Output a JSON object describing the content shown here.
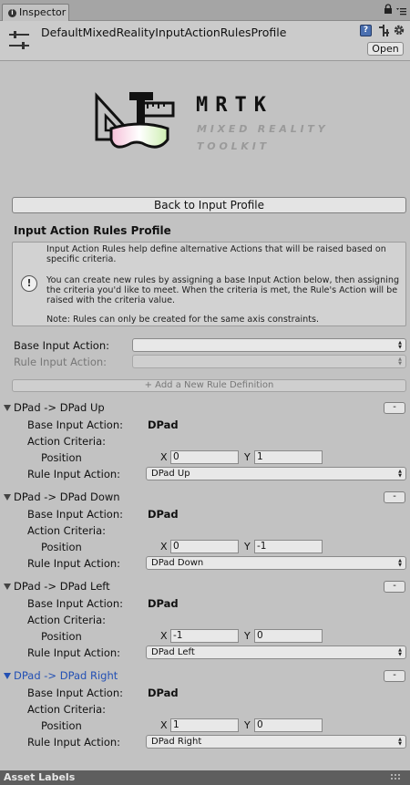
{
  "tab": {
    "title": "Inspector"
  },
  "header": {
    "title": "DefaultMixedRealityInputActionRulesProfile",
    "open_label": "Open",
    "help_glyph": "?"
  },
  "logo": {
    "name": "MRTK",
    "sub1": "MIXED REALITY",
    "sub2": "TOOLKIT"
  },
  "back_button": "Back to Input Profile",
  "section_title": "Input Action Rules Profile",
  "help": {
    "warn_glyph": "!",
    "p1": "Input Action Rules help define alternative Actions that will be raised based on specific criteria.",
    "p2": "You can create new rules by assigning a base Input Action below, then assigning the criteria you'd like to meet. When the criteria is met, the Rule's Action will be raised with the criteria value.",
    "p3": "Note: Rules can only be created for the same axis constraints."
  },
  "base_input_label": "Base Input Action:",
  "base_input_value": "",
  "rule_input_label": "Rule Input Action:",
  "rule_input_value": "",
  "add_rule_button": "+ Add a New Rule Definition",
  "labels": {
    "base": "Base Input Action:",
    "criteria": "Action Criteria:",
    "position": "Position",
    "rule": "Rule Input Action:",
    "x": "X",
    "y": "Y",
    "remove": "-"
  },
  "rules": [
    {
      "title": "DPad -> DPad Up",
      "base": "DPad",
      "x": "0",
      "y": "1",
      "rule": "DPad Up"
    },
    {
      "title": "DPad -> DPad Down",
      "base": "DPad",
      "x": "0",
      "y": "-1",
      "rule": "DPad Down"
    },
    {
      "title": "DPad -> DPad Left",
      "base": "DPad",
      "x": "-1",
      "y": "0",
      "rule": "DPad Left"
    },
    {
      "title": "DPad -> DPad Right",
      "base": "DPad",
      "x": "1",
      "y": "0",
      "rule": "DPad Right",
      "selected": true
    }
  ],
  "footer": {
    "asset_labels": "Asset Labels"
  },
  "colors": {
    "selected_text": "#2350b4",
    "panel_bg": "#c2c2c2"
  },
  "icons": [
    "info-icon",
    "lock-icon",
    "menu-icon",
    "profile-sliders-icon",
    "help-icon",
    "preset-icon",
    "gear-icon",
    "warning-icon",
    "foldout-arrow-icon",
    "dropdown-arrow-icon",
    "dots-icon"
  ]
}
